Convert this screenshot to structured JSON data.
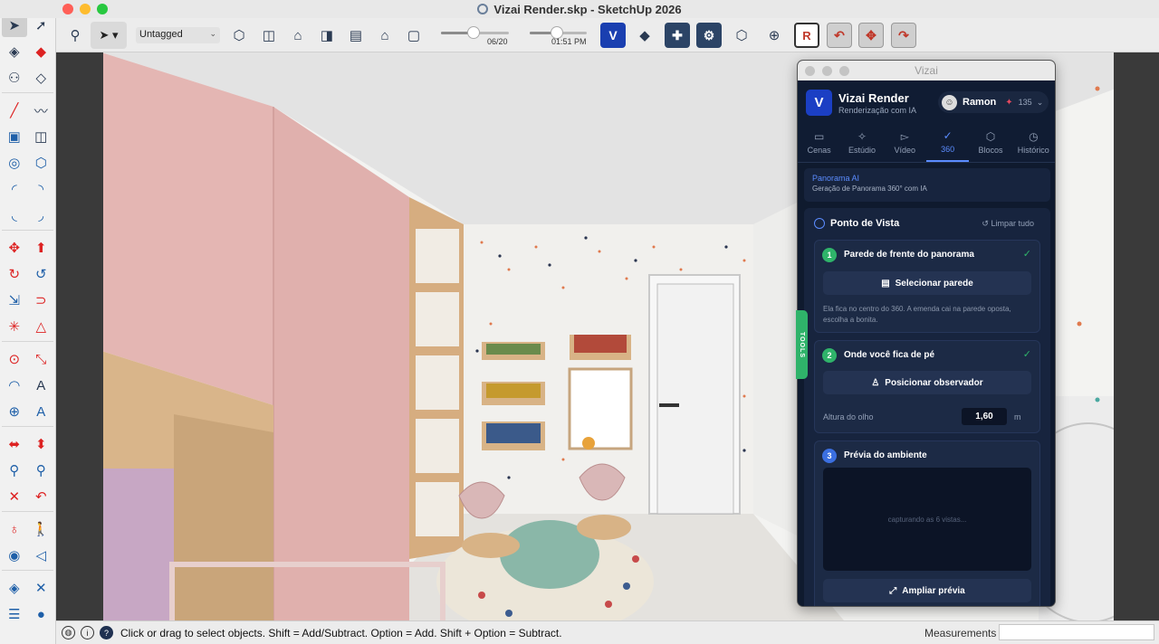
{
  "window": {
    "title": "Vizai Render.skp - SketchUp 2026"
  },
  "toolbar": {
    "tag_dropdown": "Untagged",
    "scene_slider_label": "06/20",
    "time_slider_label": "01:51 PM",
    "scene_slider_value": 0.48,
    "time_slider_value": 0.48
  },
  "statusbar": {
    "hint": "Click or drag to select objects. Shift = Add/Subtract. Option = Add. Shift + Option = Subtract.",
    "measurements_label": "Measurements",
    "measurements_value": ""
  },
  "vizai": {
    "window_title": "Vizai",
    "brand": "Vizai Render",
    "subtitle": "Renderização com IA",
    "user_name": "Ramon",
    "credits": "135",
    "tabs": [
      {
        "label": "Cenas",
        "icon": "camera-icon"
      },
      {
        "label": "Estúdio",
        "icon": "sparkles-icon"
      },
      {
        "label": "Vídeo",
        "icon": "video-icon"
      },
      {
        "label": "360",
        "icon": "check-circle-icon"
      },
      {
        "label": "Blocos",
        "icon": "hexagon-icon"
      },
      {
        "label": "Histórico",
        "icon": "clock-icon"
      }
    ],
    "active_tab": "360",
    "panorama_title": "Panorama AI",
    "panorama_subtitle": "Geração de Panorama 360° com IA",
    "section_title": "Ponto de Vista",
    "clear_all": "Limpar tudo",
    "step1": {
      "number": "1",
      "title": "Parede de frente do panorama",
      "button": "Selecionar parede",
      "help": "Ela fica no centro do 360. A emenda cai na parede oposta, escolha a bonita."
    },
    "step2": {
      "number": "2",
      "title": "Onde você fica de pé",
      "button": "Posicionar observador",
      "eye_label": "Altura do olho",
      "eye_value": "1,60",
      "eye_unit": "m"
    },
    "step3": {
      "number": "3",
      "title": "Prévia do ambiente",
      "preview_text": "capturando as 6 vistas...",
      "expand_button": "Ampliar prévia"
    },
    "tools_tab": "TOOLS"
  },
  "colors": {
    "accent": "#5b8cff",
    "success": "#2fb36a",
    "panel_bg": "#0f1a2e",
    "brand": "#1b3fc4"
  }
}
